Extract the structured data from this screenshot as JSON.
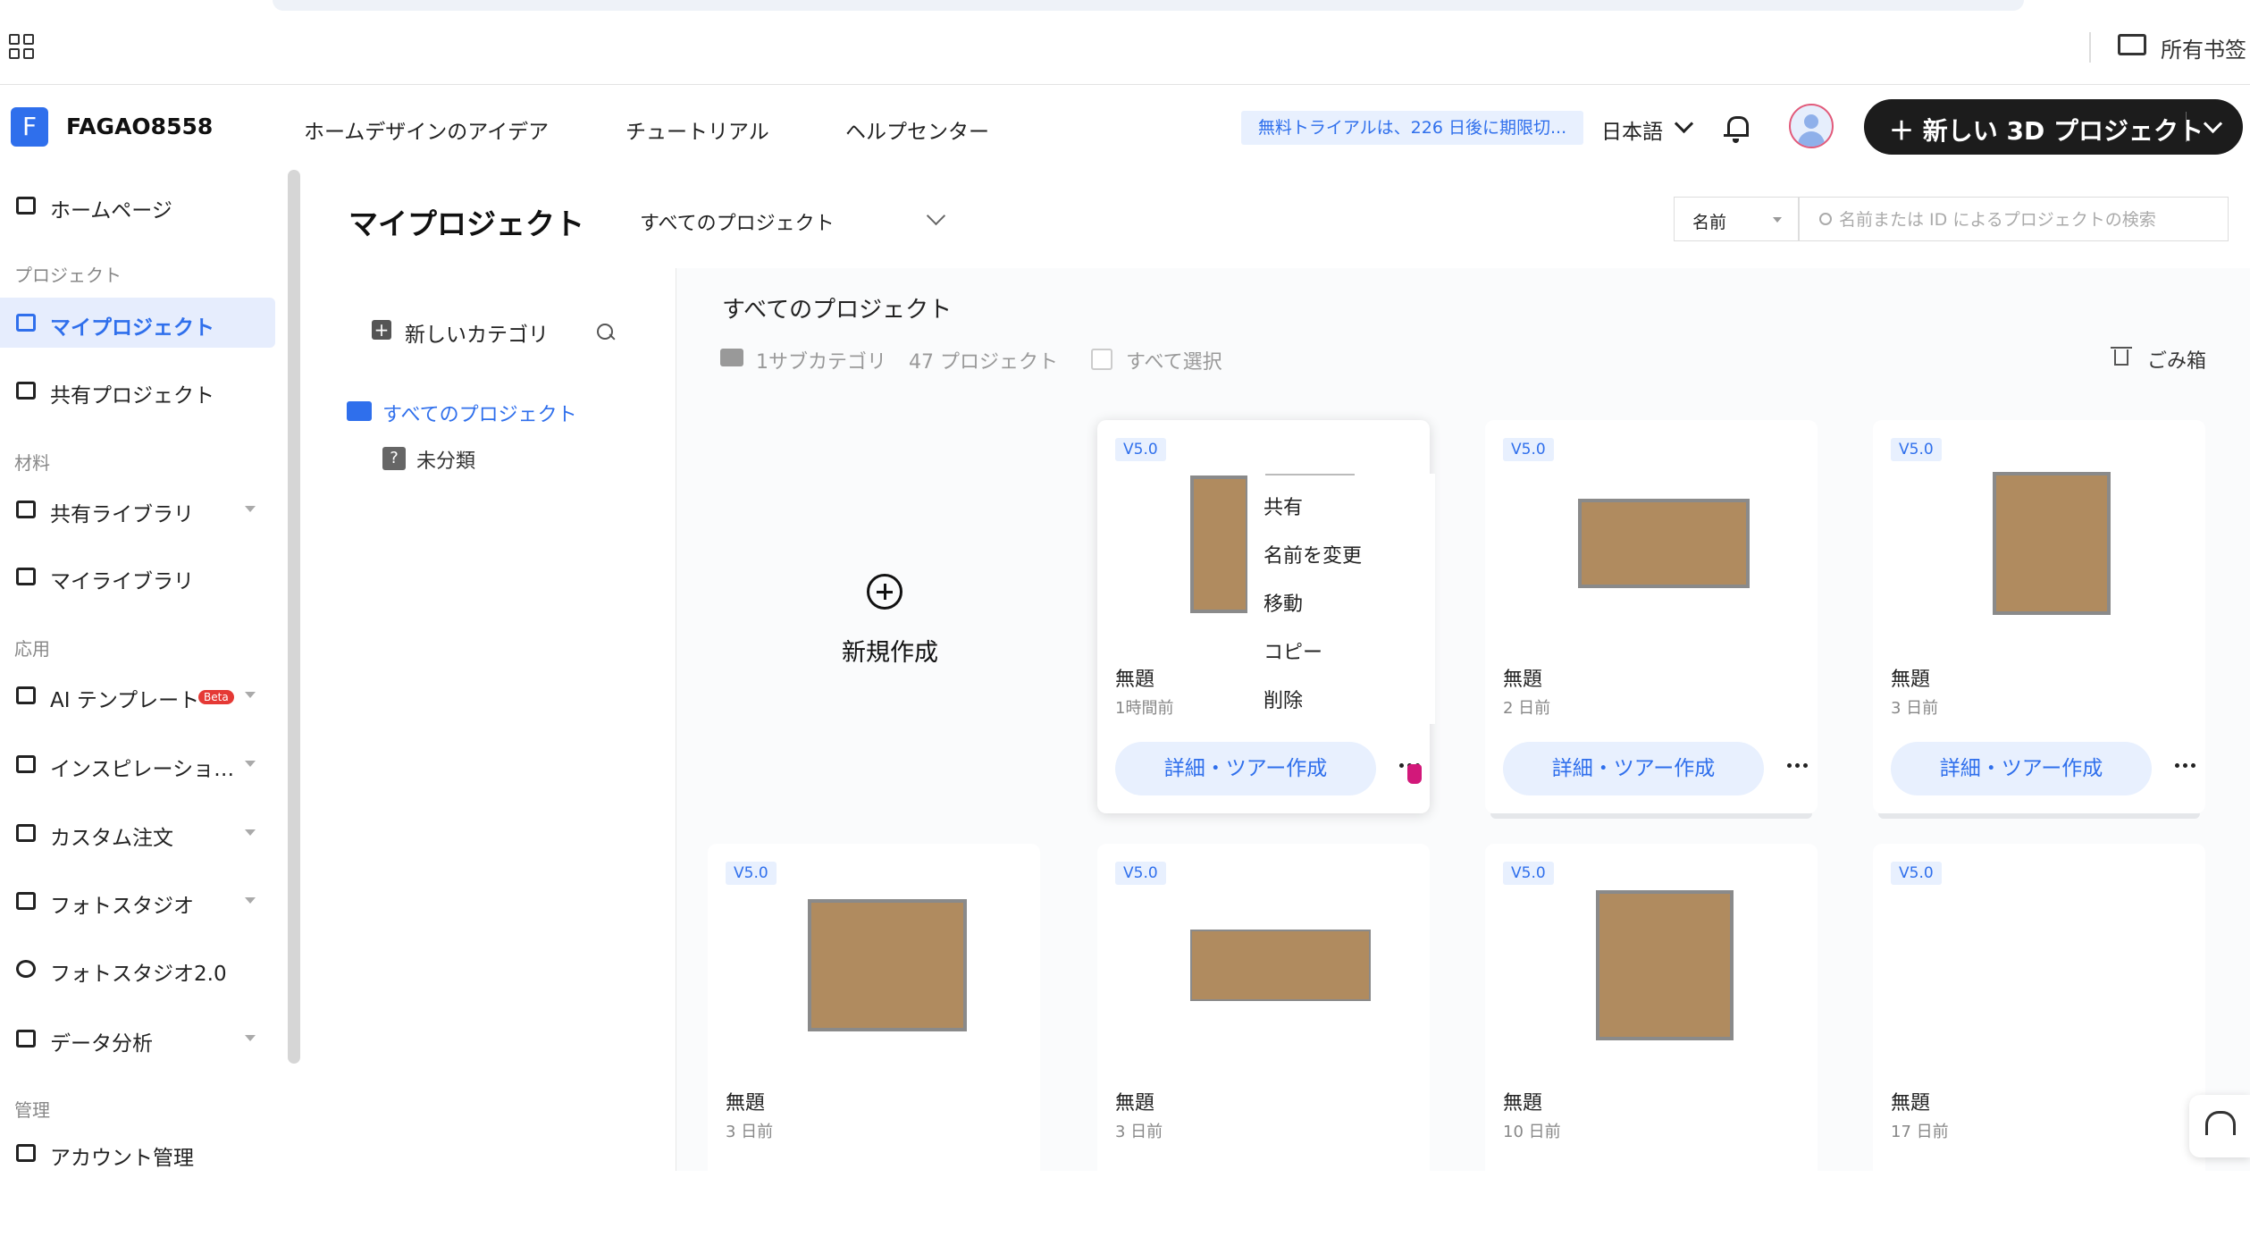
{
  "browser": {
    "bookmark_folder_label": "所有书签"
  },
  "topnav": {
    "logo_letter": "F",
    "workspace_name": "FAGAO8558",
    "links": [
      "ホームデザインのアイデア",
      "チュートリアル",
      "ヘルプセンター"
    ],
    "trial_notice": "無料トライアルは、226 日後に期限切...",
    "language": "日本語",
    "new_project_button": "＋ 新しい 3D プロジェクト"
  },
  "sidebar": {
    "sections": {
      "project": "プロジェクト",
      "material": "材料",
      "apps": "応用",
      "manage": "管理"
    },
    "items": {
      "home": "ホームページ",
      "my_projects": "マイプロジェクト",
      "shared_projects": "共有プロジェクト",
      "shared_library": "共有ライブラリ",
      "my_library": "マイライブラリ",
      "ai_template": "AI テンプレート",
      "ai_badge": "Beta",
      "inspiration": "インスピレーショ…",
      "custom_order": "カスタム注文",
      "photo_studio": "フォトスタジオ",
      "photo_studio2": "フォトスタジオ2.0",
      "data_analysis": "データ分析",
      "account_manage": "アカウント管理"
    }
  },
  "header": {
    "page_title": "マイプロジェクト",
    "project_filter": "すべてのプロジェクト",
    "sort_by": "名前",
    "search_placeholder": "名前または ID によるプロジェクトの検索"
  },
  "categories": {
    "new_category": "新しいカテゴリ",
    "all_projects": "すべてのプロジェクト",
    "uncategorized": "未分類"
  },
  "content": {
    "title": "すべてのプロジェクト",
    "subcategory_count": "1サブカテゴリ",
    "project_count": "47 プロジェクト",
    "select_all": "すべて選択",
    "trash": "ごみ箱",
    "new_create": "新規作成",
    "detail_button": "詳細・ツアー作成",
    "projects": [
      {
        "version": "V5.0",
        "name": "無題",
        "time": "1時間前"
      },
      {
        "version": "V5.0",
        "name": "無題",
        "time": "2 日前"
      },
      {
        "version": "V5.0",
        "name": "無題",
        "time": "3 日前"
      },
      {
        "version": "V5.0",
        "name": "無題",
        "time": "3 日前"
      },
      {
        "version": "V5.0",
        "name": "無題",
        "time": "3 日前"
      },
      {
        "version": "V5.0",
        "name": "無題",
        "time": "10 日前"
      },
      {
        "version": "V5.0",
        "name": "無題",
        "time": "17 日前"
      }
    ]
  },
  "context_menu": {
    "items": [
      "共有",
      "名前を変更",
      "移動",
      "コピー",
      "削除"
    ]
  },
  "colors": {
    "accent": "#2f6fec",
    "accent_light": "#e8f0fe",
    "dark_button": "#1c1c1c",
    "floor": "#b08b5f"
  }
}
